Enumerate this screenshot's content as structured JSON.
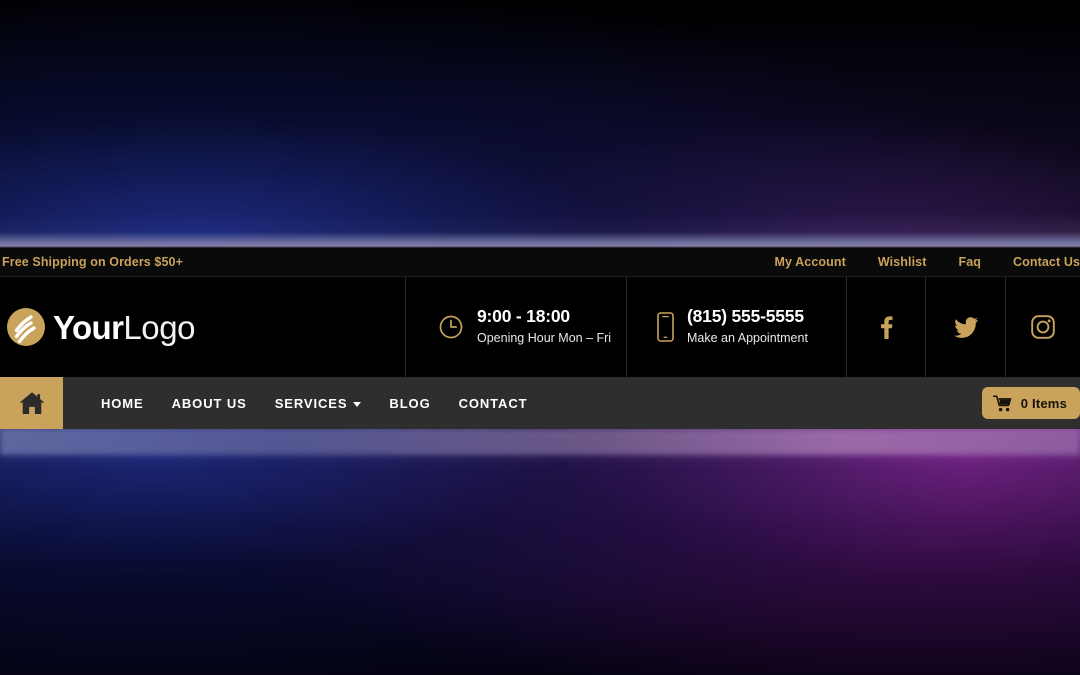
{
  "topbar": {
    "promo": "Free Shipping on Orders $50+",
    "links": [
      {
        "label": "My Account"
      },
      {
        "label": "Wishlist"
      },
      {
        "label": "Faq"
      },
      {
        "label": "Contact Us"
      }
    ]
  },
  "brand": {
    "logo_icon": "swirl-circle-logo-icon",
    "name_bold": "Your",
    "name_light": "Logo"
  },
  "info": {
    "hours": {
      "icon": "clock-icon",
      "primary": "9:00 - 18:00",
      "secondary": "Opening Hour Mon – Fri"
    },
    "phone": {
      "icon": "mobile-phone-icon",
      "primary": "(815) 555-5555",
      "secondary": "Make an Appointment"
    }
  },
  "social": [
    {
      "name": "facebook-icon",
      "label": "Facebook"
    },
    {
      "name": "twitter-icon",
      "label": "Twitter"
    },
    {
      "name": "instagram-icon",
      "label": "Instagram"
    }
  ],
  "nav": {
    "home_icon": "house-icon",
    "items": [
      {
        "label": "Home",
        "has_dropdown": false
      },
      {
        "label": "About Us",
        "has_dropdown": false
      },
      {
        "label": "Services",
        "has_dropdown": true
      },
      {
        "label": "Blog",
        "has_dropdown": false
      },
      {
        "label": "Contact",
        "has_dropdown": false
      }
    ],
    "cart": {
      "icon": "shopping-cart-icon",
      "label": "0 Items"
    }
  },
  "colors": {
    "gold": "#C9A25B",
    "navbar_bg": "#2E2E2E",
    "header_bg": "#000000",
    "topbar_bg": "#0A0A0A"
  }
}
